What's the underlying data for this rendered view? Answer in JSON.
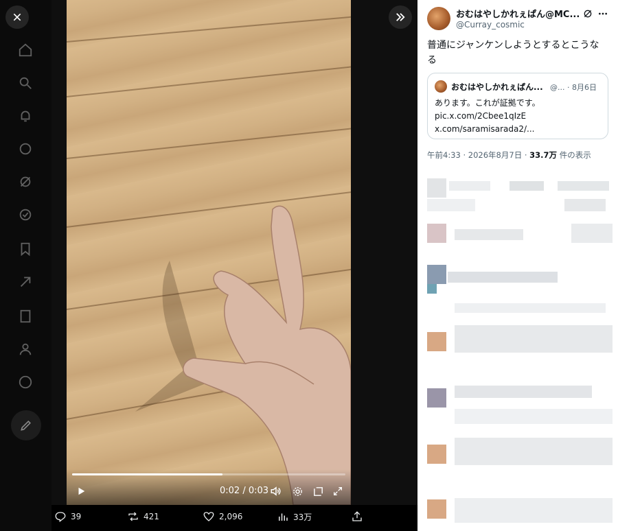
{
  "viewer": {
    "close_icon": "close-icon",
    "expand_icon": "double-chevron-right-icon"
  },
  "video": {
    "current_time": "0:02",
    "duration": "0:03",
    "time_display": "0:02 / 0:03",
    "progress_fraction": 0.55
  },
  "actions": {
    "replies": "39",
    "reposts": "421",
    "likes": "2,096",
    "views": "33万"
  },
  "post": {
    "author_name": "おむはやしかれぇぱん@MC...",
    "author_handle": "@Curray_cosmic",
    "text": "普通にジャンケンしようとするとこうなる",
    "quote": {
      "author_name": "おむはやしかれぇぱん...",
      "handle_date": "@... · 8月6日",
      "line1": "あります。これが証拠です。",
      "line2": "pic.x.com/2Cbee1qIzE",
      "line3": "x.com/saramisarada2/..."
    },
    "timestamp": "午前4:33 · 2026年8月7日 · ",
    "views_count": "33.7万",
    "views_label": " 件の表示"
  },
  "colors": {
    "accent": "#1d9bf0",
    "text_secondary": "#536471"
  }
}
